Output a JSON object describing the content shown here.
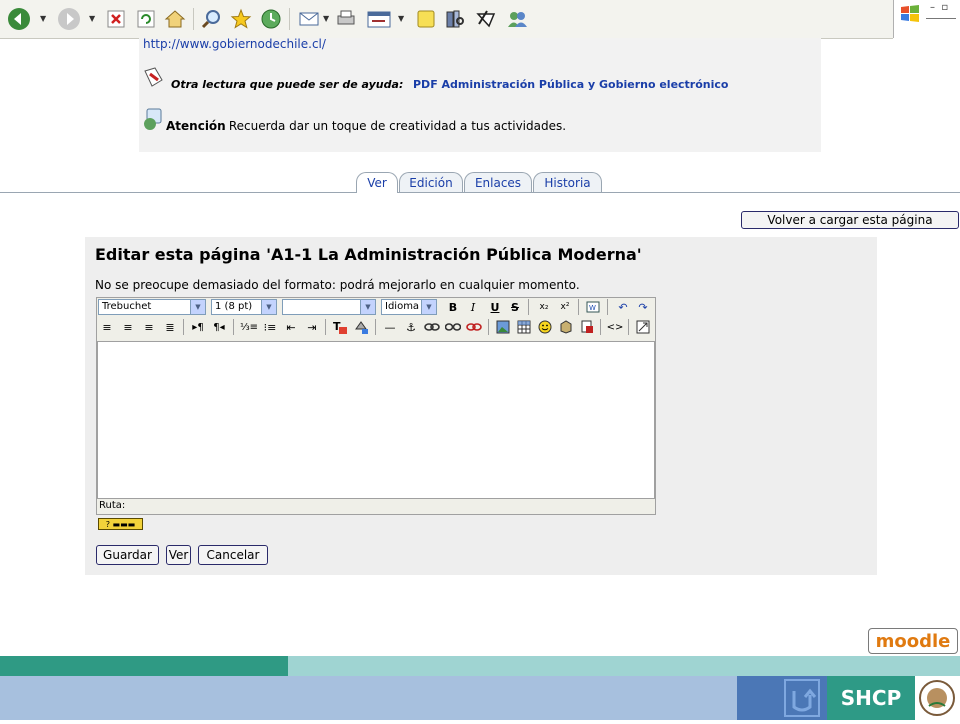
{
  "browser": {
    "toolbar_buttons": [
      "back-icon",
      "forward-icon",
      "stop-icon",
      "refresh-icon",
      "home-icon",
      "search-icon",
      "favorites-icon",
      "history-icon",
      "mail-icon",
      "print-icon",
      "edit-icon",
      "discuss-icon",
      "research-icon",
      "messenger-icon",
      "msn-icon"
    ]
  },
  "content": {
    "url_text": "http://www.gobiernodechile.cl/",
    "reading_label": "Otra lectura que puede ser de ayuda:",
    "reading_link": "PDF Administración Pública y Gobierno electrónico",
    "attention_label": "Atención",
    "attention_text": ": Recuerda dar un toque de creatividad a tus actividades."
  },
  "tabs": [
    {
      "label": "Ver",
      "active": true
    },
    {
      "label": "Edición",
      "active": false
    },
    {
      "label": "Enlaces",
      "active": false
    },
    {
      "label": "Historia",
      "active": false
    }
  ],
  "reload_button": "Volver a cargar esta página",
  "edit": {
    "title": "Editar esta página 'A1-1 La Administración Pública Moderna'",
    "note": "No se preocupe demasiado del formato: podrá mejorarlo en cualquier momento.",
    "font_select": "Trebuchet",
    "size_select": "1 (8 pt)",
    "style_select": "",
    "lang_select": "Idioma",
    "path_label": "Ruta:",
    "buttons": {
      "save": "Guardar",
      "view": "Ver",
      "cancel": "Cancelar"
    }
  },
  "footer": {
    "moodle_logo": "moodle",
    "org_logo": "SHCP"
  }
}
